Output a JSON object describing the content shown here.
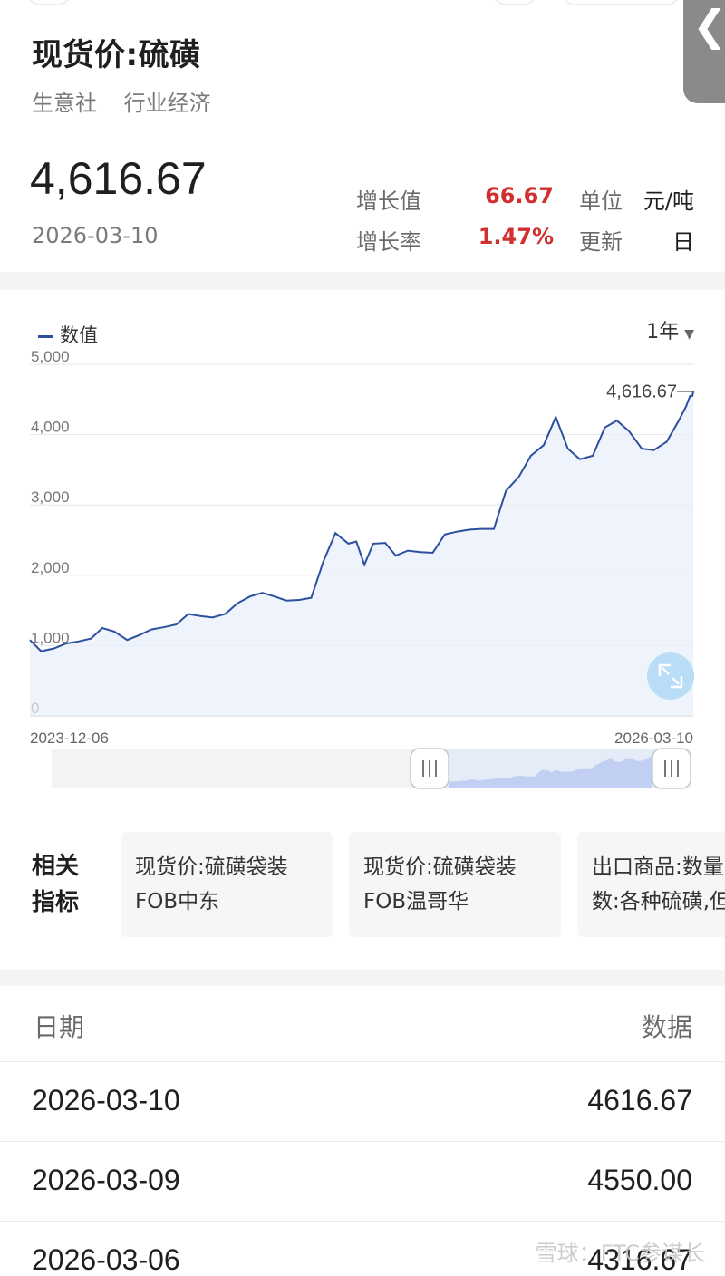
{
  "header": {
    "title": "现货价:硫磺",
    "tags": [
      "生意社",
      "行业经济"
    ],
    "value": "4,616.67",
    "date": "2026-03-10",
    "stats": {
      "growth_value_label": "增长值",
      "growth_value": "66.67",
      "growth_rate_label": "增长率",
      "growth_rate": "1.47%",
      "unit_label": "单位",
      "unit": "元/吨",
      "update_label": "更新",
      "update": "日"
    },
    "edge_tab_icon": "chevron-left-icon"
  },
  "chart": {
    "legend": "数值",
    "range": "1年",
    "last_label": "4,616.67",
    "start_date": "2023-12-06",
    "end_date": "2026-03-10",
    "y_ticks": [
      "5,000",
      "4,000",
      "3,000",
      "2,000",
      "1,000",
      "0"
    ],
    "colors": {
      "line": "#2c4f9e",
      "fill": "#e8eefb",
      "expand_button": "#b9dcf7"
    }
  },
  "chart_data": {
    "type": "area",
    "series": [
      {
        "name": "数值",
        "x": [
          "2023-12-06",
          "2023-12-20",
          "2024-01-05",
          "2024-01-20",
          "2024-02-05",
          "2024-02-20",
          "2024-03-05",
          "2024-03-20",
          "2024-04-05",
          "2024-04-20",
          "2024-05-05",
          "2024-05-20",
          "2024-06-05",
          "2024-06-20",
          "2024-07-05",
          "2024-07-20",
          "2024-08-05",
          "2024-08-20",
          "2024-09-05",
          "2024-09-20",
          "2024-10-05",
          "2024-10-20",
          "2024-11-05",
          "2024-11-20",
          "2024-12-05",
          "2024-12-20",
          "2025-01-05",
          "2025-01-15",
          "2025-01-25",
          "2025-02-05",
          "2025-02-20",
          "2025-03-05",
          "2025-03-20",
          "2025-04-05",
          "2025-04-20",
          "2025-05-05",
          "2025-05-20",
          "2025-06-05",
          "2025-06-20",
          "2025-07-05",
          "2025-07-20",
          "2025-08-05",
          "2025-08-20",
          "2025-09-05",
          "2025-09-20",
          "2025-10-05",
          "2025-10-20",
          "2025-11-05",
          "2025-11-20",
          "2025-12-05",
          "2025-12-20",
          "2026-01-05",
          "2026-01-20",
          "2026-02-05",
          "2026-02-20",
          "2026-03-01",
          "2026-03-06",
          "2026-03-09",
          "2026-03-10"
        ],
        "values": [
          1080,
          920,
          960,
          1030,
          1060,
          1100,
          1250,
          1200,
          1080,
          1150,
          1230,
          1260,
          1300,
          1450,
          1420,
          1400,
          1450,
          1600,
          1700,
          1750,
          1700,
          1640,
          1650,
          1680,
          2200,
          2600,
          2450,
          2480,
          2150,
          2450,
          2460,
          2280,
          2350,
          2330,
          2320,
          2580,
          2620,
          2650,
          2660,
          2660,
          3200,
          3400,
          3700,
          3850,
          4250,
          3800,
          3650,
          3700,
          4100,
          4200,
          4050,
          3800,
          3780,
          3900,
          4200,
          4400,
          4550,
          4550,
          4616.67
        ]
      }
    ],
    "xlabel": "",
    "ylabel": "",
    "ylim": [
      0,
      5000
    ],
    "x_tick_labels": [
      "2023-12-06",
      "2026-03-10"
    ],
    "grid": true,
    "legend": "top-left"
  },
  "related": {
    "label": "相关指标",
    "cards": [
      {
        "line1": "现货价:硫磺袋装",
        "line2": "FOB中东"
      },
      {
        "line1": "现货价:硫磺袋装",
        "line2": "FOB温哥华"
      },
      {
        "line1": "出口商品:数量",
        "line2": "数:各种硫磺,但"
      }
    ]
  },
  "table": {
    "headers": [
      "日期",
      "数据"
    ],
    "rows": [
      {
        "date": "2026-03-10",
        "value": "4616.67"
      },
      {
        "date": "2026-03-09",
        "value": "4550.00"
      },
      {
        "date": "2026-03-06",
        "value": "4316.67"
      }
    ]
  },
  "watermark": "雪球：FTC参谋长"
}
